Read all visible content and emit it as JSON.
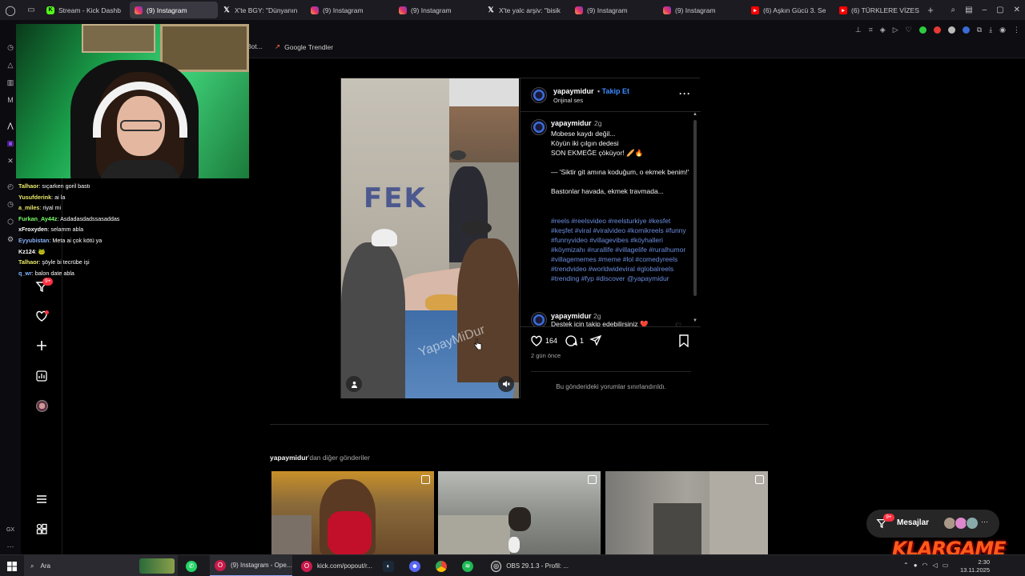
{
  "browser": {
    "tabs": [
      {
        "label": "Stream - Kick Dashb",
        "icon": "kick-icon"
      },
      {
        "label": "(9) Instagram",
        "icon": "instagram-icon",
        "active": true
      },
      {
        "label": "X'te BGY: \"Dünyanın",
        "icon": "x-icon"
      },
      {
        "label": "(9) Instagram",
        "icon": "instagram-icon"
      },
      {
        "label": "(9) Instagram",
        "icon": "instagram-icon"
      },
      {
        "label": "X'te yalc arşiv: \"bisik",
        "icon": "x-icon"
      },
      {
        "label": "(9) Instagram",
        "icon": "instagram-icon"
      },
      {
        "label": "(9) Instagram",
        "icon": "instagram-icon"
      },
      {
        "label": "(6) Aşkın Gücü 3. Se",
        "icon": "youtube-icon"
      },
      {
        "label": "(6) TÜRKLERE VİZES",
        "icon": "youtube-icon"
      }
    ],
    "bookmarks": [
      {
        "label": "Bot..."
      },
      {
        "label": "Google Trendler"
      }
    ]
  },
  "chat": [
    {
      "user": "Talhaor",
      "color": "#e8e86a",
      "msg": ": sıçarken goril bastı"
    },
    {
      "user": "Yusufderink",
      "color": "#e8e86a",
      "msg": ": ai la"
    },
    {
      "user": "a_miles",
      "color": "#e8e86a",
      "msg": ": riyal mi"
    },
    {
      "user": "Furkan_Ay44z",
      "color": "#7cff6a",
      "msg": ": Asdadasdadssasaddas"
    },
    {
      "user": "xFroxyden",
      "color": "#ffffff",
      "msg": ": selamm abla"
    },
    {
      "user": "Eyyubistan",
      "color": "#8ab4ff",
      "msg": ": Meta ai çok kötü ya"
    },
    {
      "user": "Kz124",
      "color": "#ffffff",
      "msg": ": 🐸"
    },
    {
      "user": "Talhaor",
      "color": "#e8e86a",
      "msg": ": şöyle bi tecrübe işi"
    },
    {
      "user": "q_wr",
      "color": "#8ab4ff",
      "msg": ": balon date abla"
    }
  ],
  "ig_nav": {
    "notifications_badge": "9+"
  },
  "post": {
    "username": "yapaymidur",
    "follow_label": "Takip Et",
    "separator": "•",
    "audio": "Orijinal ses",
    "caption_user": "yapaymidur",
    "caption_time": "2g",
    "caption_text": "Mobese kaydı değil...\nKöyün iki çılgın dedesi\nSON EKMEĞE çöküyor! 🥖🔥\n\n— 'Siktir git amına koduğum, o ekmek benim!'\n\nBastonlar havada, ekmek travmada...",
    "hashtags": "#reels #reelsvideo #reelsturkiye #kesfet #keşfet #viral #viralvideo #komikreels #funny #funnyvideo #villagevibes #köyhalleri #köymizahı #rurallife #villagelife #ruralhumor #villagememes #meme #lol #comedyreels #trendvideo #worldwideviral #globalreels #trending #fyp #discover @yapaymidur",
    "comment_user": "yapaymidur",
    "comment_time": "2g",
    "comment_text": "Destek için takip edebilirsiniz ❤️",
    "likes": "164",
    "comments": "1",
    "posted_ago": "2 gün önce",
    "comments_limited": "Bu gönderideki yorumlar sınırlandırıldı.",
    "watermark": "YapayMiDur",
    "wall_text": "FEK"
  },
  "more_posts": {
    "user": "yapaymidur",
    "suffix": "'dan diğer gönderiler"
  },
  "messages": {
    "label": "Mesajlar",
    "badge": "9+"
  },
  "overlay_brand": "KLARGAME",
  "taskbar": {
    "search": "Ara",
    "items": [
      {
        "label": "(9) Instagram - Ope..."
      },
      {
        "label": "kick.com/popout/r..."
      },
      {
        "label": "OBS 29.1.3 - Profil: ..."
      }
    ],
    "time": "2:30",
    "date": "13.11.2025"
  },
  "colors": {
    "accent_link": "#3d8bff",
    "hashtag": "#6b8ddf",
    "notify_red": "#ff3040"
  }
}
